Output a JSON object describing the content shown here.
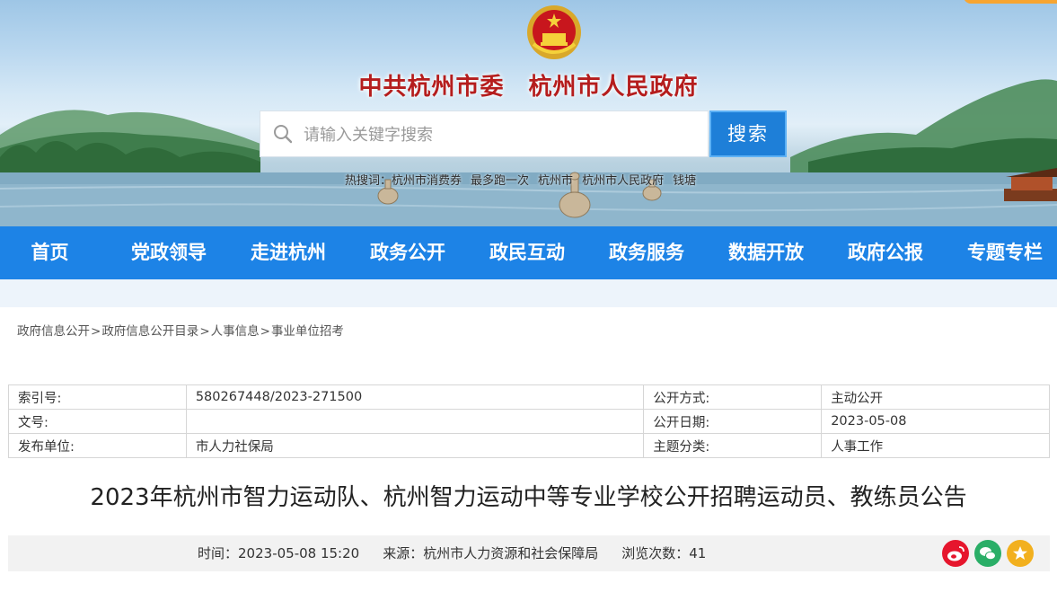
{
  "header": {
    "site_title": "中共杭州市委　杭州市人民政府",
    "emblem": "national-emblem"
  },
  "search": {
    "placeholder": "请输入关键字搜索",
    "value": "",
    "button_label": "搜索",
    "hot_label": "热搜词：",
    "hot_words": [
      "杭州市消费券",
      "最多跑一次",
      "杭州市",
      "杭州市人民政府",
      "钱塘"
    ]
  },
  "nav": {
    "items": [
      "首页",
      "党政领导",
      "走进杭州",
      "政务公开",
      "政民互动",
      "政务服务",
      "数据开放",
      "政府公报",
      "专题专栏"
    ]
  },
  "breadcrumb": [
    "政府信息公开",
    "政府信息公开目录",
    "人事信息",
    "事业单位招考"
  ],
  "meta": {
    "index_no_label": "索引号:",
    "index_no": "580267448/2023-271500",
    "open_mode_label": "公开方式:",
    "open_mode": "主动公开",
    "doc_no_label": "文号:",
    "doc_no": "",
    "open_date_label": "公开日期:",
    "open_date": "2023-05-08",
    "issuer_label": "发布单位:",
    "issuer": "市人力社保局",
    "category_label": "主题分类:",
    "category": "人事工作"
  },
  "article": {
    "title": "2023年杭州市智力运动队、杭州智力运动中等专业学校公开招聘运动员、教练员公告",
    "time_label": "时间：",
    "time": "2023-05-08 15:20",
    "source_label": "来源：",
    "source": "杭州市人力资源和社会保障局",
    "views_label": "浏览次数：",
    "views": "41"
  },
  "share": {
    "icons": [
      "weibo-icon",
      "wechat-icon",
      "favorite-star-icon"
    ],
    "colors": {
      "weibo": "#e6162d",
      "wechat": "#2aae67",
      "favorite": "#f2b01e"
    }
  },
  "colors": {
    "nav_bg": "#1d83e6",
    "title_red": "#b51d1d",
    "search_button": "#1e7fd8",
    "accent_orange": "#f7a531"
  }
}
